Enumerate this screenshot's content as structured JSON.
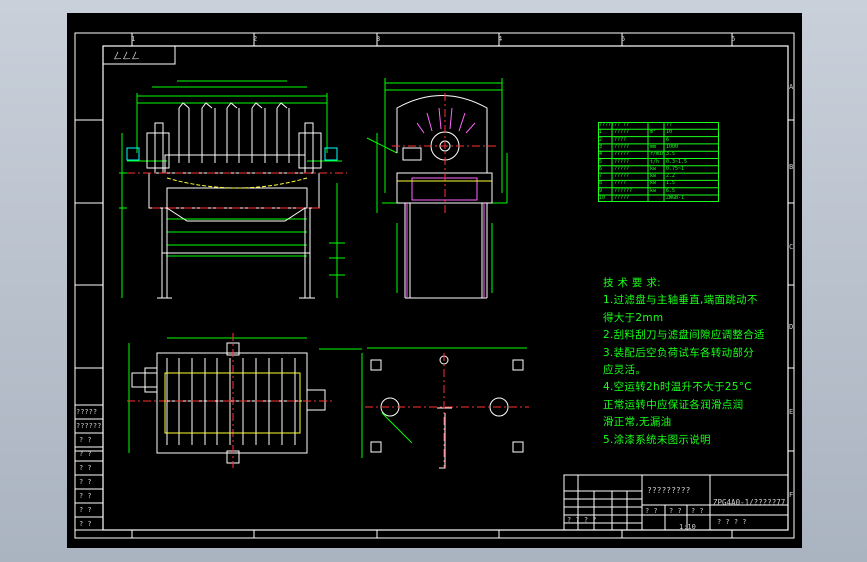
{
  "colors": {
    "frame": "#ffffff",
    "line": "#ffffff",
    "dim": "#00ff00",
    "green_text": "#19ff19",
    "yellow": "#ffff33",
    "red": "#ff3030",
    "cyan": "#00ffff",
    "magenta": "#ff66ff",
    "sheet_bg": "#000000"
  },
  "corner_stamp": "ㄥㄥㄥ",
  "zones": {
    "top": [
      "1",
      "2",
      "3",
      "4",
      "5",
      "6"
    ],
    "side": [
      "A",
      "B",
      "C",
      "D",
      "E",
      "F"
    ]
  },
  "technical_requirements": {
    "title": "技 术 要 求:",
    "lines": [
      "1.过滤盘与主轴垂直,端面跳动不",
      "得大于2mm",
      "2.刮料刮刀与滤盘间隙应调整合适",
      "3.装配后空负荷试车各转动部分",
      "应灵活。",
      "4.空运转2h时温升不大于25°C",
      "  正常运转中应保证各润滑点润",
      "滑正常,无漏油",
      "5.涂漆系统未图示说明"
    ]
  },
  "parameter_table": {
    "rows": [
      [
        "?????",
        "?? ??",
        "",
        "??"
      ],
      [
        "1",
        "?????",
        "m²",
        "10"
      ],
      [
        "2",
        "????",
        "",
        "6"
      ],
      [
        "3",
        "?????",
        "mm",
        "1000"
      ],
      [
        "4",
        "?????",
        "r/min",
        "3.5"
      ],
      [
        "5",
        "?????",
        "t/h",
        "0.3~1.5"
      ],
      [
        "6",
        "?????",
        "kw",
        "0.75~1"
      ],
      [
        "7",
        "?????",
        "kw",
        "2.2"
      ],
      [
        "8",
        "????",
        "kw",
        "1.5"
      ],
      [
        "9",
        "??????",
        "kw",
        "6.5"
      ],
      [
        "10",
        "?????",
        "",
        "ZWGB-1"
      ]
    ]
  },
  "left_list": [
    "?????",
    "??????",
    "? ?",
    "? ?",
    "? ?",
    "? ?",
    "? ?",
    "? ?",
    "? ?"
  ],
  "title_block": {
    "name": "?????????",
    "drawing_no": "ZPG4A0-1/?????77",
    "scale": "1:10",
    "small_cells": [
      "? ? ? ?",
      "? ?",
      "? ?",
      "? ?",
      "? ? ? ?",
      "1:10"
    ]
  }
}
